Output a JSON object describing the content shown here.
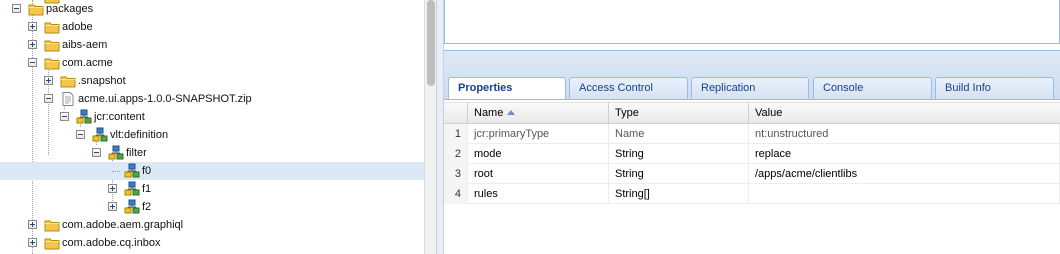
{
  "tree": {
    "nodes": [
      {
        "label": "packages",
        "icon": "folder-icon",
        "toggle": "minus"
      },
      {
        "label": "adobe",
        "icon": "folder-icon",
        "toggle": "plus"
      },
      {
        "label": "aibs-aem",
        "icon": "folder-icon",
        "toggle": "plus"
      },
      {
        "label": "com.acme",
        "icon": "folder-icon",
        "toggle": "minus"
      },
      {
        "label": ".snapshot",
        "icon": "folder-icon",
        "toggle": "plus"
      },
      {
        "label": "acme.ui.apps-1.0.0-SNAPSHOT.zip",
        "icon": "file-icon",
        "toggle": "minus"
      },
      {
        "label": "jcr:content",
        "icon": "node-icon",
        "toggle": "minus"
      },
      {
        "label": "vlt:definition",
        "icon": "node-icon",
        "toggle": "minus"
      },
      {
        "label": "filter",
        "icon": "node-icon",
        "toggle": "minus"
      },
      {
        "label": "f0",
        "icon": "node-icon",
        "toggle": "none",
        "selected": true
      },
      {
        "label": "f1",
        "icon": "node-icon",
        "toggle": "plus"
      },
      {
        "label": "f2",
        "icon": "node-icon",
        "toggle": "plus"
      },
      {
        "label": "com.adobe.aem.graphiql",
        "icon": "folder-icon",
        "toggle": "plus"
      },
      {
        "label": "com.adobe.cq.inbox",
        "icon": "folder-icon",
        "toggle": "plus"
      }
    ]
  },
  "tabs": [
    {
      "label": "Properties",
      "active": true
    },
    {
      "label": "Access Control"
    },
    {
      "label": "Replication"
    },
    {
      "label": "Console"
    },
    {
      "label": "Build Info"
    }
  ],
  "grid": {
    "columns": {
      "name": "Name",
      "type": "Type",
      "value": "Value"
    },
    "sorted_column": "Name",
    "rows": [
      {
        "num": "1",
        "name": "jcr:primaryType",
        "type": "Name",
        "value": "nt:unstructured",
        "readonly": true
      },
      {
        "num": "2",
        "name": "mode",
        "type": "String",
        "value": "replace"
      },
      {
        "num": "3",
        "name": "root",
        "type": "String",
        "value": "/apps/acme/clientlibs"
      },
      {
        "num": "4",
        "name": "rules",
        "type": "String[]",
        "value": ""
      }
    ]
  },
  "colors": {
    "selection": "#dbe8f6",
    "tab_text": "#15428b",
    "panel_border": "#99bbe8",
    "folder": "#f3c84a"
  }
}
